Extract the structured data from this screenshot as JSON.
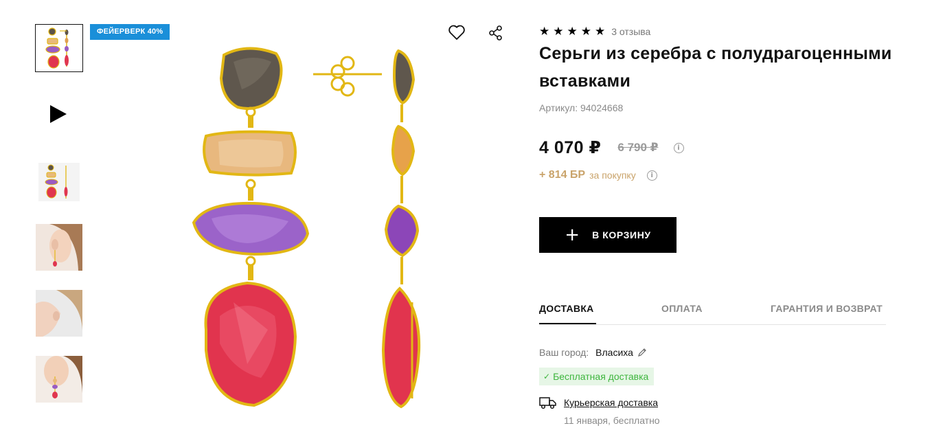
{
  "badge": "ФЕЙЕРВЕРК 40%",
  "media": {
    "thumbnails": [
      "earrings-thumb",
      "video-thumb",
      "earrings-thumb-2",
      "model-ear-thumb-1",
      "model-ear-thumb-2",
      "model-ear-thumb-3"
    ],
    "main_image": "earrings-main-image"
  },
  "product": {
    "rating_stars": "★★★★★",
    "reviews": "3 отзыва",
    "title": "Серьги из серебра с полудрагоценными вставками",
    "article": "Артикул: 94024668",
    "price": "4 070 ₽",
    "old_price": "6 790 ₽",
    "bonus": "+ 814 БР",
    "bonus_note": "за покупку",
    "info_glyph": "i"
  },
  "cart": {
    "plus": "+",
    "label": "В КОРЗИНУ"
  },
  "tabs": [
    {
      "label": "ДОСТАВКА",
      "active": true
    },
    {
      "label": "ОПЛАТА",
      "active": false
    },
    {
      "label": "ГАРАНТИЯ И ВОЗВРАТ",
      "active": false
    }
  ],
  "delivery": {
    "city_label": "Ваш город:",
    "city": "Власиха",
    "free_check": "✓",
    "free_label": "Бесплатная доставка",
    "courier_label": "Курьерская доставка",
    "courier_date": "11 января, бесплатно"
  },
  "colors": {
    "badge": "#1a8fd9",
    "gold": "#e2b714",
    "bonus": "#c9a36a",
    "free_bg": "#e6f6e6",
    "free_text": "#3db53d"
  }
}
